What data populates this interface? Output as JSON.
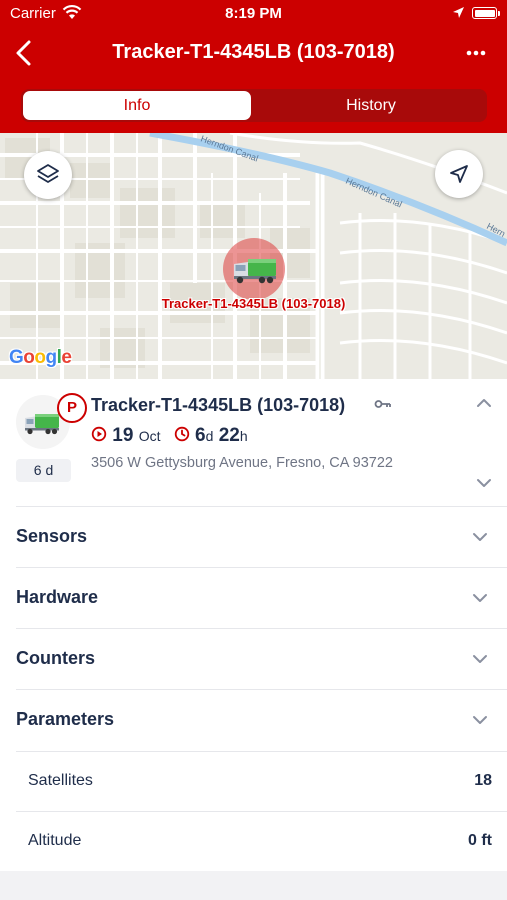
{
  "status_bar": {
    "carrier": "Carrier",
    "time": "8:19 PM"
  },
  "nav": {
    "title": "Tracker-T1-4345LB (103-7018)",
    "back_icon": "chevron-left-icon",
    "more_icon": "more-icon"
  },
  "tabs": [
    {
      "label": "Info",
      "active": true
    },
    {
      "label": "History",
      "active": false
    }
  ],
  "map": {
    "marker_label": "Tracker-T1-4345LB (103-7018)",
    "street_labels": [
      "Herndon Canal",
      "Herndon Canal",
      "Hern"
    ],
    "google_logo": [
      "G",
      "o",
      "o",
      "g",
      "l",
      "e"
    ],
    "google_colors": [
      "#4285f4",
      "#ea4335",
      "#fbbc05",
      "#4285f4",
      "#34a853",
      "#ea4335"
    ],
    "layers_icon": "layers-icon",
    "locate_icon": "navigation-arrow-icon"
  },
  "unit": {
    "name": "Tracker-T1-4345LB (103-7018)",
    "parking_badge": "P",
    "duration": "6 d",
    "date_day": "19",
    "date_month": "Oct",
    "elapsed_days": "6",
    "elapsed_days_unit": "d",
    "elapsed_hours": "22",
    "elapsed_hours_unit": "h",
    "address": "3506 W Gettysburg Avenue, Fresno, CA 93722"
  },
  "sections": [
    {
      "label": "Sensors"
    },
    {
      "label": "Hardware"
    },
    {
      "label": "Counters"
    },
    {
      "label": "Parameters"
    }
  ],
  "parameters": [
    {
      "label": "Satellites",
      "value": "18"
    },
    {
      "label": "Altitude",
      "value": "0 ft"
    }
  ],
  "colors": {
    "brand": "#cc0000",
    "text": "#1f2d4a",
    "muted": "#6f7585",
    "truck": "#45b54a"
  }
}
